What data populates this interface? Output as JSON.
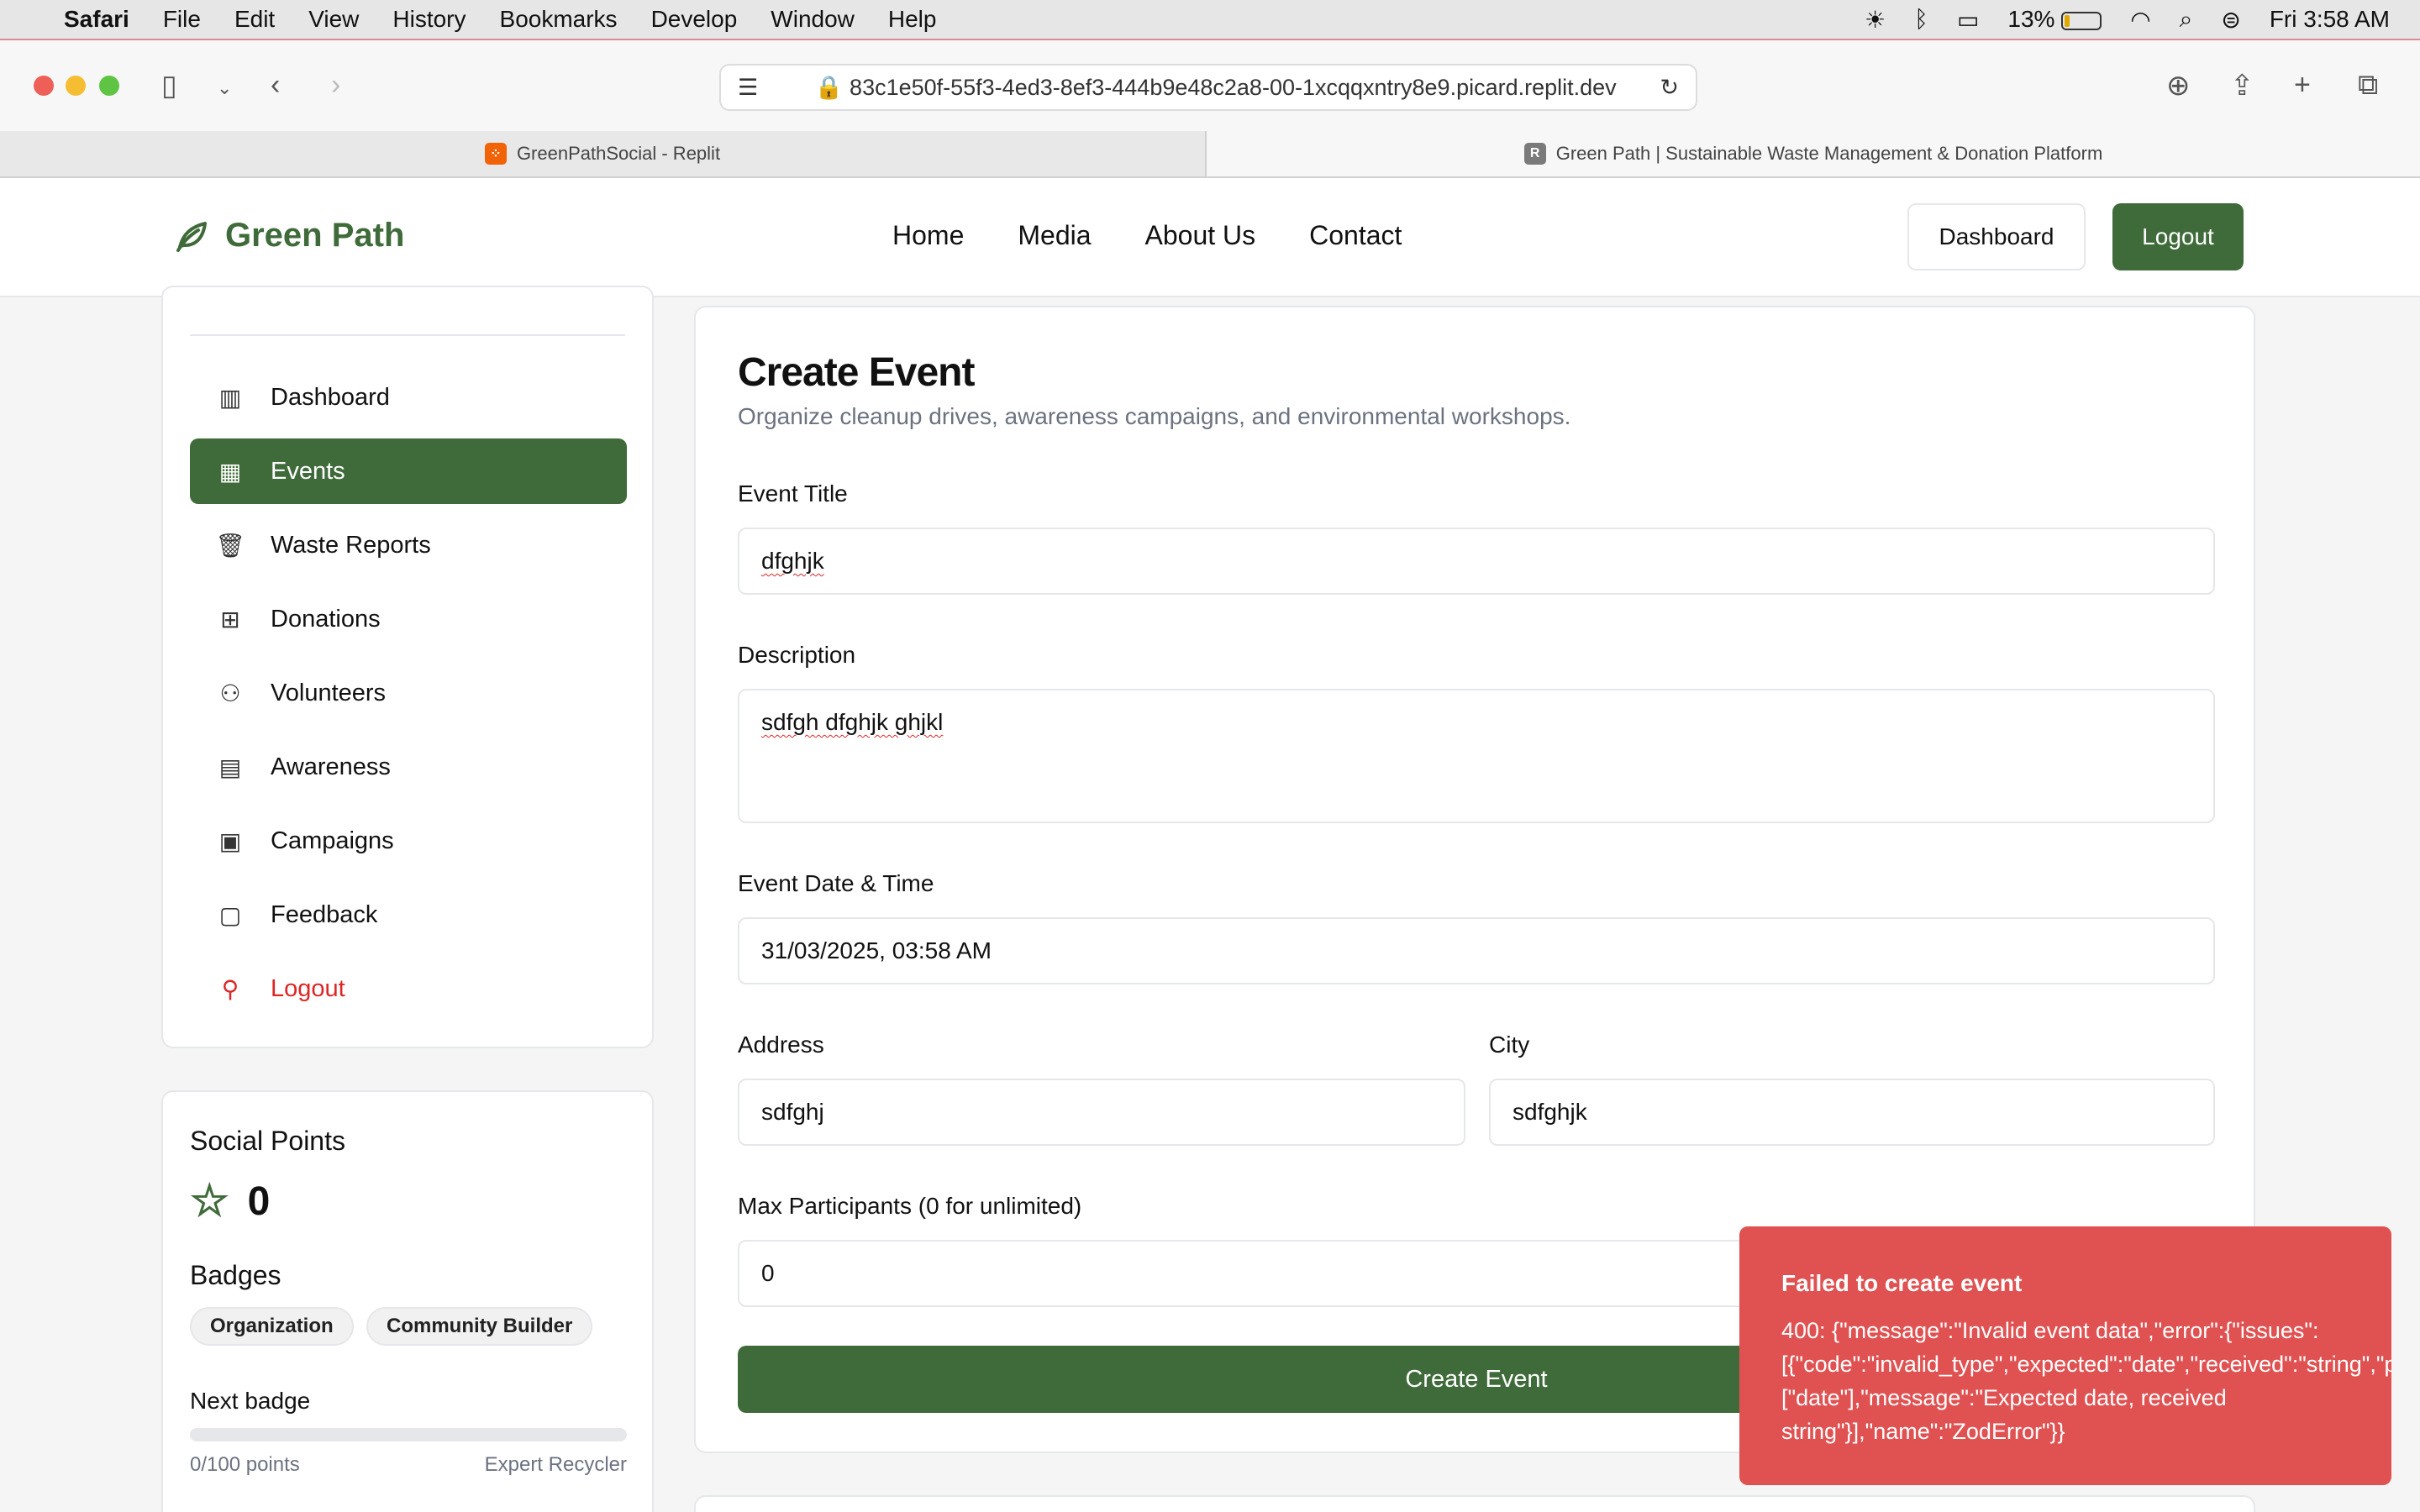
{
  "menubar": {
    "app": "Safari",
    "items": [
      "File",
      "Edit",
      "View",
      "History",
      "Bookmarks",
      "Develop",
      "Window",
      "Help"
    ],
    "battery": "13%",
    "clock": "Fri 3:58 AM"
  },
  "browser": {
    "url": "83c1e50f-55f3-4ed3-8ef3-444b9e48c2a8-00-1xcqqxntry8e9.picard.replit.dev",
    "tabs": [
      {
        "title": "GreenPathSocial - Replit"
      },
      {
        "title": "Green Path | Sustainable Waste Management & Donation Platform"
      }
    ]
  },
  "header": {
    "brand": "Green Path",
    "nav": [
      "Home",
      "Media",
      "About Us",
      "Contact"
    ],
    "dashboard_btn": "Dashboard",
    "logout_btn": "Logout"
  },
  "sidebar": {
    "items": [
      {
        "label": "Dashboard",
        "icon": "bar-chart-icon"
      },
      {
        "label": "Events",
        "icon": "calendar-icon",
        "active": true
      },
      {
        "label": "Waste Reports",
        "icon": "trash-icon"
      },
      {
        "label": "Donations",
        "icon": "gift-icon"
      },
      {
        "label": "Volunteers",
        "icon": "users-icon"
      },
      {
        "label": "Awareness",
        "icon": "newspaper-icon"
      },
      {
        "label": "Campaigns",
        "icon": "building-icon"
      },
      {
        "label": "Feedback",
        "icon": "message-icon"
      },
      {
        "label": "Logout",
        "icon": "user-icon"
      }
    ]
  },
  "points": {
    "title": "Social Points",
    "value": "0",
    "badges_title": "Badges",
    "badges": [
      "Organization",
      "Community Builder"
    ],
    "next_label": "Next badge",
    "progress": 0,
    "progress_text": "0/100 points",
    "next_badge": "Expert Recycler"
  },
  "form": {
    "title": "Create Event",
    "subtitle": "Organize cleanup drives, awareness campaigns, and environmental workshops.",
    "title_label": "Event Title",
    "title_value": "dfghjk",
    "desc_label": "Description",
    "desc_value": "sdfgh dfghjk ghjkl",
    "date_label": "Event Date & Time",
    "date_value": "31/03/2025, 03:58 AM",
    "address_label": "Address",
    "address_value": "sdfghj",
    "city_label": "City",
    "city_value": "sdfghjk",
    "max_label": "Max Participants (0 for unlimited)",
    "max_value": "0",
    "submit": "Create Event"
  },
  "toast": {
    "title": "Failed to create event",
    "lines": [
      "400: {\"message\":\"Invalid event data\",\"error\":{\"issues\":",
      "[{\"code\":\"invalid_type\",\"expected\":\"date\",\"received\":\"string\",\"path\":",
      "[\"date\"],\"message\":\"Expected date, received",
      "string\"}],\"name\":\"ZodError\"}}"
    ]
  },
  "colors": {
    "brand_green": "#3f6b3a",
    "danger": "#dc2626",
    "toast_red": "#e05252"
  }
}
